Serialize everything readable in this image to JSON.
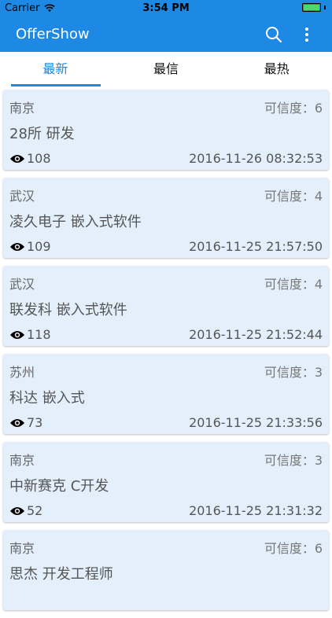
{
  "status_bar": {
    "carrier": "Carrier",
    "time": "3:54 PM",
    "battery_level": 1.0,
    "battery_color": "#4cd964"
  },
  "header": {
    "title": "OfferShow",
    "search_icon": "search-icon",
    "more_icon": "more-vertical-icon",
    "color": "#1e88e5"
  },
  "tabs": [
    {
      "label": "最新",
      "active": true
    },
    {
      "label": "最信",
      "active": false
    },
    {
      "label": "最热",
      "active": false
    }
  ],
  "posts": [
    {
      "city": "南京",
      "credibility": "可信度：6",
      "job": "28所  研发",
      "views": "108",
      "time": "2016-11-26 08:32:53"
    },
    {
      "city": "武汉",
      "credibility": "可信度：4",
      "job": "凌久电子  嵌入式软件",
      "views": "109",
      "time": "2016-11-25 21:57:50"
    },
    {
      "city": "武汉",
      "credibility": "可信度：4",
      "job": "联发科  嵌入式软件",
      "views": "118",
      "time": "2016-11-25 21:52:44"
    },
    {
      "city": "苏州",
      "credibility": "可信度：3",
      "job": "科达  嵌入式",
      "views": "73",
      "time": "2016-11-25 21:33:56"
    },
    {
      "city": "南京",
      "credibility": "可信度：3",
      "job": "中新赛克  C开发",
      "views": "52",
      "time": "2016-11-25 21:31:32"
    },
    {
      "city": "南京",
      "credibility": "可信度：6",
      "job": "思杰  开发工程师",
      "views": "",
      "time": ""
    }
  ]
}
